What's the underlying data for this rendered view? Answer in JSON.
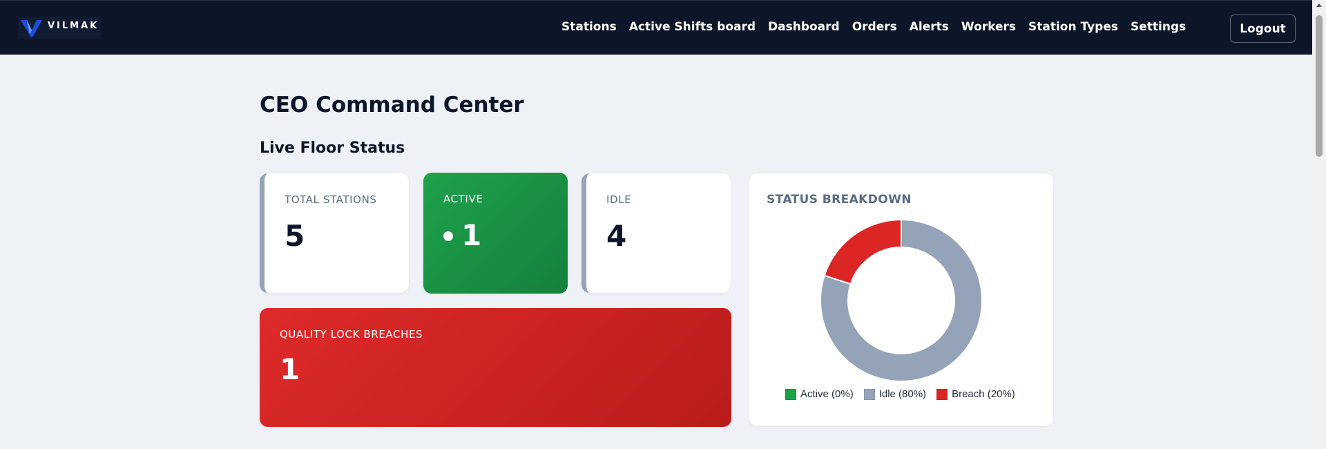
{
  "nav": {
    "logo_text": "VILMAK",
    "links": [
      "Stations",
      "Active Shifts board",
      "Dashboard",
      "Orders",
      "Alerts",
      "Workers",
      "Station Types",
      "Settings"
    ],
    "logout_label": "Logout"
  },
  "page": {
    "title": "CEO Command Center",
    "section_title": "Live Floor Status"
  },
  "cards": {
    "total": {
      "label": "TOTAL STATIONS",
      "value": "5"
    },
    "active": {
      "label": "ACTIVE",
      "value": "1"
    },
    "idle": {
      "label": "IDLE",
      "value": "4"
    },
    "breach": {
      "label": "QUALITY LOCK BREACHES",
      "value": "1"
    }
  },
  "colors": {
    "active": "#16a34a",
    "idle": "#94a3b8",
    "breach": "#dc2626",
    "navbar": "#0d1628"
  },
  "chart_data": {
    "type": "pie",
    "title": "STATUS BREAKDOWN",
    "series": [
      {
        "name": "Active",
        "value": 0,
        "legend": "Active (0%)",
        "color": "#16a34a"
      },
      {
        "name": "Idle",
        "value": 80,
        "legend": "Idle (80%)",
        "color": "#94a3b8"
      },
      {
        "name": "Breach",
        "value": 20,
        "legend": "Breach (20%)",
        "color": "#dc2626"
      }
    ],
    "legend_position": "bottom"
  }
}
